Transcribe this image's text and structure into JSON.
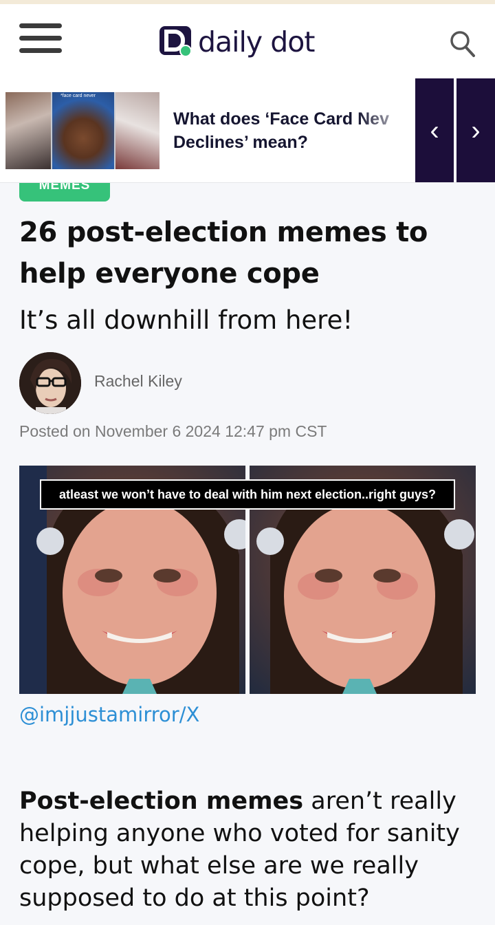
{
  "header": {
    "logo_text": "daily dot",
    "menu_icon": "hamburger-menu-icon",
    "search_icon": "search-icon",
    "brand_color": "#1d1440",
    "accent_color": "#36c27a"
  },
  "promo": {
    "title_line1": "What does ‘Face Card Nev",
    "title_line2": "Declines’ mean?",
    "thumb_caption": "*face card never",
    "prev_label": "‹",
    "next_label": "›",
    "button_color": "#1c0e3a"
  },
  "article": {
    "category": "MEMES",
    "headline": "26 post-election memes to help everyone cope",
    "subheadline": "It’s all downhill from here!",
    "author": "Rachel Kiley",
    "posted": "Posted on November 6 2024 12:47 pm CST",
    "image_caption": "atleast we won’t have to deal with him next election..right guys?",
    "image_credit": "@imjjustamirror/X",
    "body_bold": "Post-election memes",
    "body_rest": " aren’t really helping anyone who voted for sanity cope, but what else are we really supposed to do at this point?",
    "link_color": "#2d8fd5"
  }
}
